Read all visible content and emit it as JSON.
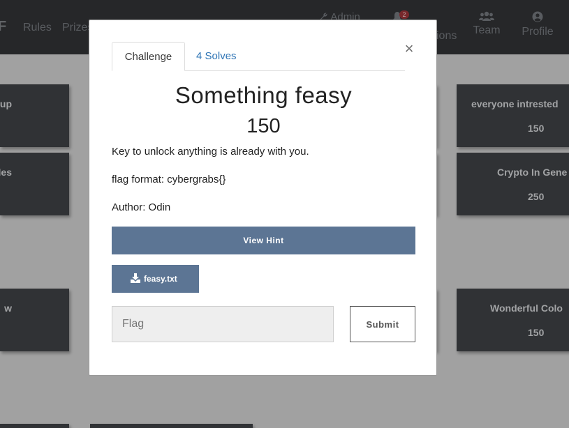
{
  "navbar": {
    "brand": "F",
    "links": [
      "Rules",
      "Prizes"
    ],
    "admin": "Admin",
    "notification_count": "2",
    "challenges_partial": "ions",
    "team": "Team",
    "profile": "Profile",
    "icons": {
      "admin": "wrench-icon",
      "notifications": "bell-icon",
      "team": "users-icon",
      "profile": "user-circle-icon"
    }
  },
  "cards": [
    {
      "title": "up",
      "points": ""
    },
    {
      "title": "ollows Rules",
      "points": ""
    },
    {
      "title": "w",
      "points": ""
    },
    {
      "title": "everyone intrested",
      "points": "150"
    },
    {
      "title": "Crypto In Gene",
      "points": "250"
    },
    {
      "title": "Wonderful Colo",
      "points": "150"
    }
  ],
  "modal": {
    "tabs": {
      "challenge": "Challenge",
      "solves": "4 Solves"
    },
    "close": "×",
    "title": "Something feasy",
    "points": "150",
    "description": [
      "Key to unlock anything is already with you.",
      "flag format: cybergrabs{}",
      "Author: Odin"
    ],
    "hint_button": "View Hint",
    "file_button": "feasy.txt",
    "flag_placeholder": "Flag",
    "flag_value": "",
    "submit_button": "Submit",
    "icons": {
      "file": "download-icon",
      "close": "close-icon"
    }
  },
  "colors": {
    "navbar_bg": "#1e1f22",
    "card_bg": "#2b2f33",
    "button_bg": "#5c7594",
    "tab_active_link": "#2e74b5",
    "badge": "#8e1f24"
  }
}
